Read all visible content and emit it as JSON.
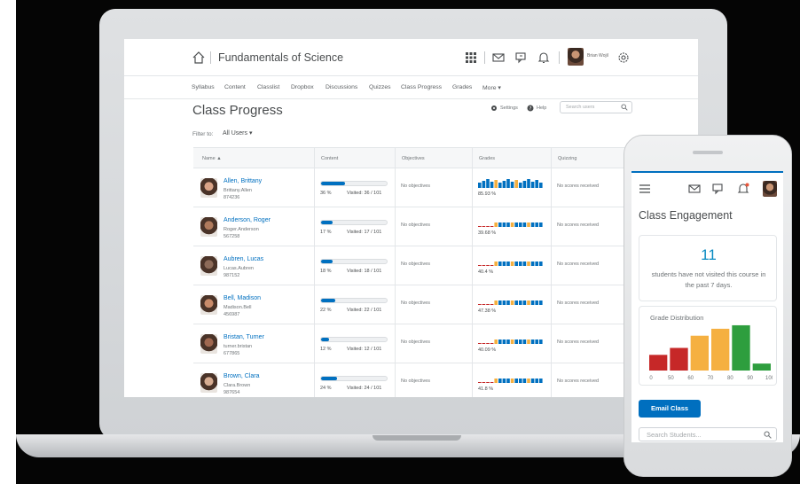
{
  "course": {
    "title": "Fundamentals of Science"
  },
  "user": {
    "name": "Brian Wojil"
  },
  "nav": {
    "items": [
      "Syllabus",
      "Content",
      "Classlist",
      "Dropbox",
      "Discussions",
      "Quizzes",
      "Class Progress",
      "Grades",
      "More ▾"
    ]
  },
  "page": {
    "title": "Class Progress",
    "settings_label": "Settings",
    "help_label": "Help",
    "search_placeholder": "Search users",
    "filter_label": "Filter to:",
    "filter_value": "All Users ▾"
  },
  "table": {
    "columns": [
      "Name ▲",
      "Content",
      "Objectives",
      "Grades",
      "Quizzing"
    ],
    "rows": [
      {
        "name": "Allen, Brittany",
        "username": "Brittany.Allen",
        "id": "874236",
        "content_pct": "36 %",
        "content_value": 0.36,
        "visited": "Visited: 36 / 101",
        "objectives": "No objectives",
        "grade": "85.93 %",
        "quizzing": "No scores received",
        "photo": "#d9a387"
      },
      {
        "name": "Anderson, Roger",
        "username": "Roger.Anderson",
        "id": "567258",
        "content_pct": "17 %",
        "content_value": 0.17,
        "visited": "Visited: 17 / 101",
        "objectives": "No objectives",
        "grade": "39.68 %",
        "quizzing": "No scores received",
        "photo": "#b07a5c"
      },
      {
        "name": "Aubren, Lucas",
        "username": "Lucas.Aubren",
        "id": "987152",
        "content_pct": "18 %",
        "content_value": 0.18,
        "visited": "Visited: 18 / 101",
        "objectives": "No objectives",
        "grade": "40.4 %",
        "quizzing": "No scores received",
        "photo": "#8c6a58"
      },
      {
        "name": "Bell, Madison",
        "username": "Madison.Bell",
        "id": "456987",
        "content_pct": "22 %",
        "content_value": 0.22,
        "visited": "Visited: 22 / 101",
        "objectives": "No objectives",
        "grade": "47.38 %",
        "quizzing": "No scores received",
        "photo": "#c98b6a"
      },
      {
        "name": "Bristan, Turner",
        "username": "turner.bristan",
        "id": "677865",
        "content_pct": "12 %",
        "content_value": 0.12,
        "visited": "Visited: 12 / 101",
        "objectives": "No objectives",
        "grade": "40.09 %",
        "quizzing": "No scores received",
        "photo": "#a06850"
      },
      {
        "name": "Brown, Clara",
        "username": "Clara.Brown",
        "id": "987654",
        "content_pct": "24 %",
        "content_value": 0.24,
        "visited": "Visited: 24 / 101",
        "objectives": "No objectives",
        "grade": "41.8 %",
        "quizzing": "No scores received",
        "photo": "#d7ad92"
      }
    ]
  },
  "phone": {
    "title": "Class Engagement",
    "not_visited_count": "11",
    "not_visited_text": "students have not visited this course in the past 7 days.",
    "grade_distribution_title": "Grade Distribution",
    "email_button": "Email Class",
    "search_placeholder": "Search Students..."
  },
  "colors": {
    "accent": "#006fbf",
    "low": "#c62828",
    "mid": "#f5b041",
    "high": "#2e9e3e",
    "link": "#0070c0"
  },
  "chart_data": {
    "type": "bar",
    "title": "Grade Distribution",
    "categories": [
      "0",
      "50",
      "60",
      "70",
      "80",
      "90",
      "100"
    ],
    "x_ticks": [
      "0",
      "50",
      "60",
      "70",
      "80",
      "90",
      "100"
    ],
    "values": [
      18,
      26,
      40,
      48,
      52,
      8
    ],
    "bar_colors": [
      "#c62828",
      "#c62828",
      "#f5b041",
      "#f5b041",
      "#2e9e3e",
      "#2e9e3e"
    ],
    "ylim": [
      0,
      55
    ],
    "grid": false
  }
}
